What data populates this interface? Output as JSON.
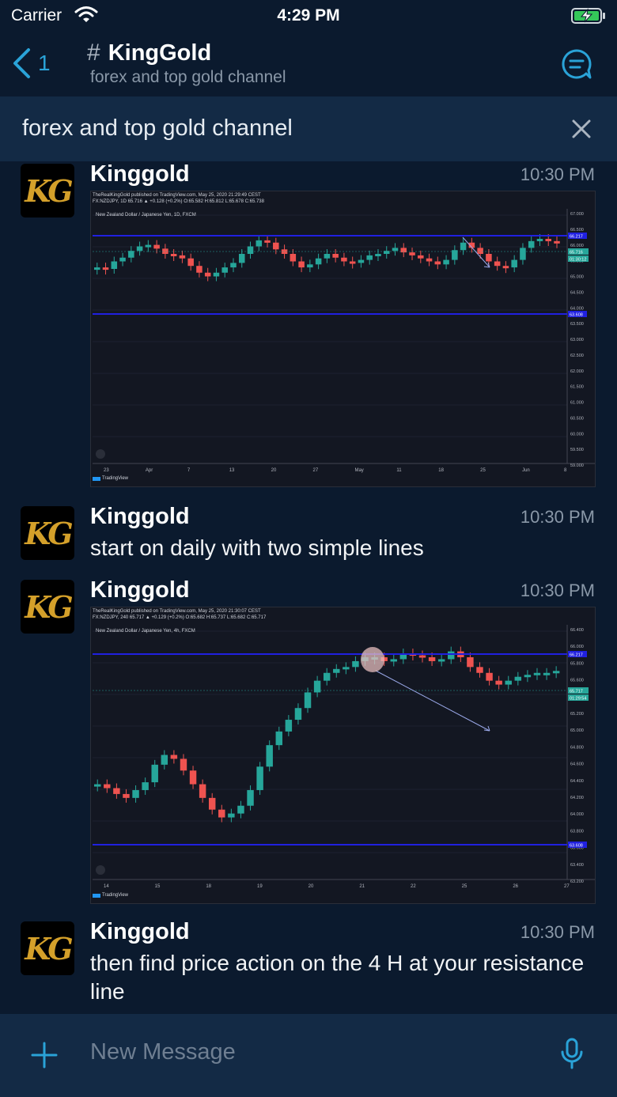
{
  "status": {
    "carrier": "Carrier",
    "time": "4:29 PM"
  },
  "nav": {
    "back_count": "1",
    "hash": "#",
    "channel_name": "KingGold",
    "channel_subtitle": "forex and top gold channel"
  },
  "banner": {
    "text": "forex and top gold channel"
  },
  "messages": [
    {
      "author": "Kinggold",
      "time": "10:30 PM",
      "avatar_text": "KG",
      "chart": {
        "header1": "TheRealKingGold published on TradingView.com, May 25, 2020 21:29:49 CEST",
        "header2": "FX:NZDJPY, 1D  65.716 ▲ +0.128 (+0.2%)  O:65.582  H:65.812  L:65.678  C:65.738",
        "pair": "New Zealand Dollar / Japanese Yen, 1D, FXCM",
        "brand": "TradingView"
      }
    },
    {
      "author": "Kinggold",
      "time": "10:30 PM",
      "avatar_text": "KG",
      "text": "start on daily with two simple lines"
    },
    {
      "author": "Kinggold",
      "time": "10:30 PM",
      "avatar_text": "KG",
      "chart": {
        "header1": "TheRealKingGold published on TradingView.com, May 25, 2020 21:30:07 CEST",
        "header2": "FX:NZDJPY, 240  65.717 ▲ +0.129 (+0.2%)  O:65.682  H:65.737  L:65.682  C:65.717",
        "pair": "New Zealand Dollar / Japanese Yen, 4h, FXCM",
        "brand": "TradingView"
      }
    },
    {
      "author": "Kinggold",
      "time": "10:30 PM",
      "avatar_text": "KG",
      "text": "then find price action on the 4 H at your resistance line"
    }
  ],
  "composer": {
    "placeholder": "New Message"
  },
  "colors": {
    "accent": "#2aa3d8",
    "background": "#0b1a2e",
    "bar": "#132a45",
    "bull": "#26a69a",
    "bear": "#ef5350",
    "level": "#2020e0"
  },
  "icons": [
    "wifi-icon",
    "battery-charging-icon",
    "back-chevron-icon",
    "hash-icon",
    "thread-icon",
    "close-icon",
    "plus-icon",
    "mic-icon"
  ],
  "charts": [
    {
      "y_ticks": [
        "67.000",
        "66.500",
        "66.000",
        "65.500",
        "65.000",
        "64.500",
        "64.000",
        "63.500",
        "63.000",
        "62.500",
        "62.000",
        "61.500",
        "61.000",
        "60.500",
        "60.000",
        "59.500",
        "59.000"
      ],
      "x_ticks": [
        "23",
        "Apr",
        "7",
        "13",
        "20",
        "27",
        "May",
        "11",
        "18",
        "25",
        "Jun",
        "8"
      ],
      "levels": [
        "66.217",
        "63.608"
      ],
      "price_labels": [
        "65.716",
        "01:30:12"
      ]
    },
    {
      "y_ticks": [
        "66.400",
        "66.000",
        "65.800",
        "65.600",
        "65.400",
        "65.200",
        "65.000",
        "64.800",
        "64.600",
        "64.400",
        "64.200",
        "64.000",
        "63.800",
        "63.600",
        "63.400",
        "63.200"
      ],
      "x_ticks": [
        "14",
        "15",
        "18",
        "19",
        "20",
        "21",
        "22",
        "25",
        "26",
        "27"
      ],
      "levels": [
        "66.217",
        "63.608"
      ],
      "price_labels": [
        "65.717",
        "01:29:54"
      ]
    }
  ]
}
